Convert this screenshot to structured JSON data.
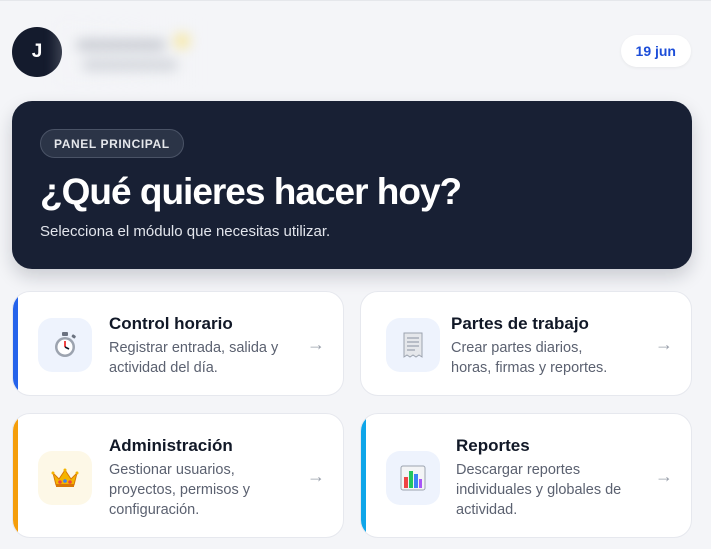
{
  "header": {
    "avatar_initial": "J",
    "date": "19 jun"
  },
  "hero": {
    "badge": "PANEL PRINCIPAL",
    "title": "¿Qué quieres hacer hoy?",
    "subtitle": "Selecciona el módulo que necesitas utilizar."
  },
  "modules": [
    {
      "title": "Control horario",
      "desc_lines": [
        "Registrar entrada, salida y",
        "actividad del día."
      ],
      "icon": "stopwatch-icon",
      "accent": "#2563eb",
      "icon_bg": "#eef3fd"
    },
    {
      "title": "Partes de trabajo",
      "desc_lines": [
        "Crear partes diarios,",
        "horas, firmas y reportes."
      ],
      "icon": "document-icon",
      "accent": "#ffffff",
      "icon_bg": "#eef3fd"
    },
    {
      "title": "Administración",
      "desc_lines": [
        "Gestionar usuarios,",
        "proyectos, permisos y",
        "configuración."
      ],
      "icon": "crown-icon",
      "accent": "#f59e0b",
      "icon_bg": "#fdf8e7"
    },
    {
      "title": "Reportes",
      "desc_lines": [
        "Descargar reportes",
        "individuales y globales de",
        "actividad."
      ],
      "icon": "bar-chart-icon",
      "accent": "#0ea5e9",
      "icon_bg": "#eef3fd"
    }
  ],
  "arrow": "→"
}
